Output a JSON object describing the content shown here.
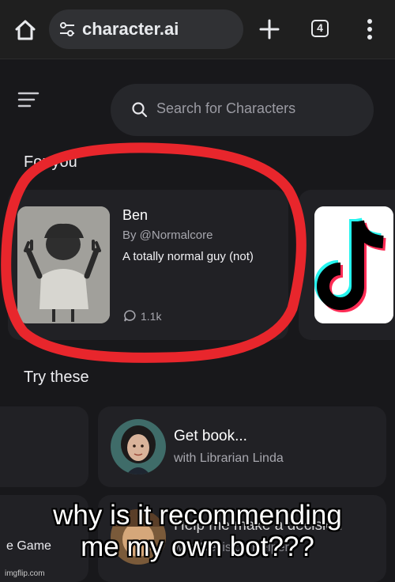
{
  "browser": {
    "url": "character.ai",
    "tab_count": "4"
  },
  "app": {
    "search_placeholder": "Search for Characters",
    "sections": {
      "for_you": "For you",
      "try_these": "Try these"
    },
    "for_you_cards": [
      {
        "name": "Ben",
        "creator": "By @Normalcore",
        "description": "A totally normal guy (not)",
        "chats": "1.1k"
      }
    ],
    "try_these_cards": [
      {
        "title": "Get book...",
        "subtitle": "with Librarian Linda"
      },
      {
        "title": "Help me make a decision",
        "subtitle": "with Decision Helper"
      }
    ],
    "partial_label": "e Game"
  },
  "caption": {
    "line1": "why is it recommending",
    "line2": "me my own bot???"
  },
  "watermark": "imgflip.com",
  "colors": {
    "background": "#18181b",
    "card": "#212125",
    "annotation_red": "#e8262c"
  }
}
